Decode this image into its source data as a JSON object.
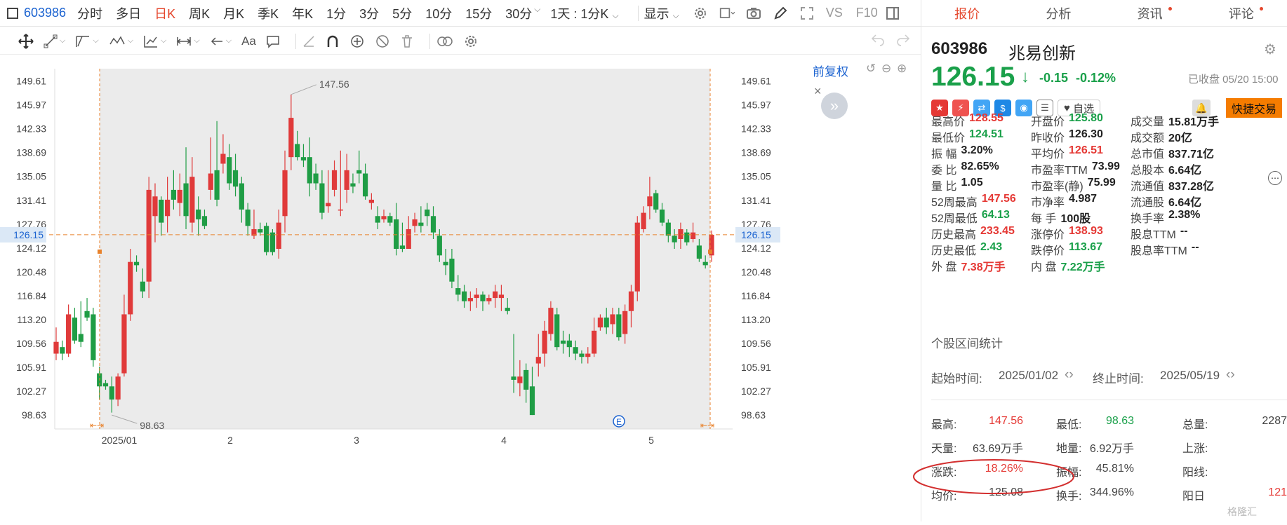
{
  "topbar": {
    "code": "603986",
    "periods": [
      "分时",
      "多日",
      "日K",
      "周K",
      "月K",
      "季K",
      "年K",
      "1分",
      "3分",
      "5分",
      "10分",
      "15分",
      "30分"
    ],
    "active": "日K",
    "range": "1天 : 1分K",
    "display": "显示",
    "vs": "VS",
    "f10": "F10"
  },
  "chart": {
    "restore": "前复权",
    "price_ticks": [
      "149.61",
      "145.97",
      "142.33",
      "138.69",
      "135.05",
      "131.41",
      "127.76",
      "124.12",
      "120.48",
      "116.84",
      "113.20",
      "109.56",
      "105.91",
      "102.27",
      "98.63"
    ],
    "current_price": "126.15",
    "high_label": "147.56",
    "low_label": "98.63",
    "x_labels": [
      "2025/01",
      "2",
      "3",
      "4",
      "5"
    ],
    "marker": "E"
  },
  "candles": [
    [
      108,
      109.8,
      107,
      112
    ],
    [
      109,
      108,
      107,
      110
    ],
    [
      108,
      114,
      107.5,
      115.5
    ],
    [
      113.5,
      110,
      109.5,
      115
    ],
    [
      111,
      109.8,
      109,
      116
    ],
    [
      114.5,
      113.5,
      113,
      116.5
    ],
    [
      114,
      107,
      106,
      115
    ],
    [
      105,
      103,
      101,
      106
    ],
    [
      103.5,
      103,
      102.5,
      104
    ],
    [
      103,
      101,
      99,
      104.5
    ],
    [
      101,
      104.5,
      100,
      105
    ],
    [
      105,
      114,
      104.5,
      117
    ],
    [
      114,
      122,
      113,
      124
    ],
    [
      122,
      121.5,
      120.5,
      123
    ],
    [
      119,
      117.5,
      116.5,
      121
    ],
    [
      119,
      133,
      116.5,
      135
    ],
    [
      129,
      132,
      125,
      134
    ],
    [
      131.5,
      128,
      126,
      132
    ],
    [
      129,
      131.5,
      126.5,
      135
    ],
    [
      133,
      131.5,
      130,
      136
    ],
    [
      131,
      133,
      129,
      135.5
    ],
    [
      134,
      129,
      127,
      139.5
    ],
    [
      128,
      135,
      126.5,
      138
    ],
    [
      130,
      128.5,
      126,
      132
    ],
    [
      129,
      127.5,
      127,
      130
    ],
    [
      133,
      135.5,
      131.5,
      141
    ],
    [
      136,
      131.5,
      130.5,
      143.5
    ],
    [
      137,
      138.5,
      135.5,
      141.5
    ],
    [
      138,
      134,
      133,
      140
    ],
    [
      136,
      133.5,
      132,
      138.5
    ],
    [
      134,
      130,
      128,
      135
    ],
    [
      130,
      127.5,
      126,
      131
    ],
    [
      126,
      127,
      125.5,
      130
    ],
    [
      127,
      126.5,
      126,
      128
    ],
    [
      127.5,
      123.5,
      123,
      128
    ],
    [
      126.5,
      123.5,
      123,
      127
    ],
    [
      124,
      128,
      122.5,
      130
    ],
    [
      129,
      136,
      126.5,
      139
    ],
    [
      138,
      144,
      136,
      147.56
    ],
    [
      140,
      138,
      137.5,
      142
    ],
    [
      138,
      137.5,
      136.5,
      140
    ],
    [
      138,
      134,
      132,
      141
    ],
    [
      135.5,
      134,
      133,
      137
    ],
    [
      134,
      129.5,
      128.5,
      136
    ],
    [
      130.5,
      131,
      129.5,
      136
    ],
    [
      133,
      136,
      132,
      137.5
    ],
    [
      130,
      130,
      129,
      139
    ],
    [
      133,
      136,
      131,
      138.5
    ],
    [
      134,
      133.5,
      132.5,
      135.5
    ],
    [
      136,
      135.5,
      134,
      139
    ],
    [
      135.5,
      132,
      131.5,
      137
    ],
    [
      131,
      131.5,
      130,
      132.5
    ],
    [
      129,
      128,
      127,
      130.5
    ],
    [
      128.5,
      129,
      128,
      130
    ],
    [
      129,
      128,
      127.5,
      129.5
    ],
    [
      128.5,
      124,
      123,
      131
    ],
    [
      124.5,
      124,
      123.5,
      128
    ],
    [
      124,
      127,
      124,
      129
    ],
    [
      127.5,
      128.5,
      126.5,
      129.5
    ],
    [
      128,
      127.5,
      126.5,
      130.5
    ],
    [
      130,
      129,
      127.5,
      131
    ],
    [
      129,
      126.5,
      125.5,
      130.5
    ],
    [
      126,
      123,
      122,
      127
    ],
    [
      122,
      121.5,
      120,
      124
    ],
    [
      122.5,
      119,
      118,
      124
    ],
    [
      118,
      117,
      116,
      120
    ],
    [
      117.5,
      116,
      115,
      118.5
    ],
    [
      116,
      116.5,
      114.5,
      117.5
    ],
    [
      116.5,
      117,
      115,
      118
    ],
    [
      117,
      116,
      114.5,
      117.5
    ],
    [
      116,
      116.5,
      115.5,
      117
    ],
    [
      116.5,
      117.5,
      115,
      118.5
    ],
    [
      116.5,
      117,
      114.5,
      118.5
    ],
    [
      115,
      114.5,
      114,
      116.5
    ],
    [
      104.5,
      104,
      102,
      111
    ],
    [
      103.5,
      104.5,
      101.5,
      107
    ],
    [
      105.5,
      102.5,
      100.5,
      106.5
    ],
    [
      103,
      98.63,
      98.63,
      106
    ],
    [
      106.5,
      107.5,
      104.5,
      111
    ],
    [
      108,
      111.5,
      106,
      113
    ],
    [
      111,
      115,
      110,
      116
    ],
    [
      114,
      109,
      108.5,
      115
    ],
    [
      110,
      109.5,
      108,
      111.5
    ],
    [
      110,
      109,
      107.5,
      111
    ],
    [
      109,
      108,
      107,
      110
    ],
    [
      108,
      107.5,
      106.5,
      108.5
    ],
    [
      107.5,
      108,
      106.5,
      109
    ],
    [
      108,
      111.5,
      107.5,
      113.5
    ],
    [
      112,
      113.5,
      111.5,
      114
    ],
    [
      113.5,
      112,
      111,
      115
    ],
    [
      112.5,
      114,
      111,
      115
    ],
    [
      114,
      110.5,
      110,
      115
    ],
    [
      111,
      114.5,
      109.5,
      115.5
    ],
    [
      114.5,
      117.5,
      112,
      118.5
    ],
    [
      117.5,
      128,
      116,
      129
    ],
    [
      127,
      129.5,
      126.5,
      130.5
    ],
    [
      130.5,
      132,
      128.5,
      135
    ],
    [
      132.5,
      130,
      129.5,
      133
    ],
    [
      130,
      128,
      127.5,
      131
    ],
    [
      128,
      126,
      125,
      128.5
    ],
    [
      126,
      125,
      124,
      127
    ],
    [
      125.5,
      127,
      124,
      128
    ],
    [
      126.5,
      125,
      124.5,
      127
    ],
    [
      125.5,
      126.5,
      125,
      128
    ],
    [
      124.5,
      122.5,
      122,
      125.5
    ],
    [
      122,
      121.5,
      121,
      123
    ],
    [
      123,
      126.15,
      122,
      126.8
    ]
  ],
  "right_panel": {
    "tabs": [
      "报价",
      "分析",
      "资讯",
      "评论"
    ],
    "active": "报价",
    "code": "603986",
    "name": "兆易创新",
    "price": "126.15",
    "change": "-0.15",
    "pct": "-0.12%",
    "closed": "已收盘 05/20 15:00",
    "watch": "自选",
    "quick_trade": "快捷交易",
    "stats": [
      [
        [
          "最高价",
          "128.55",
          "red"
        ],
        [
          "开盘价",
          "125.80",
          "green"
        ],
        [
          "成交量",
          "15.81万手",
          "dark"
        ]
      ],
      [
        [
          "最低价",
          "124.51",
          "green"
        ],
        [
          "昨收价",
          "126.30",
          "dark"
        ],
        [
          "成交额",
          "20亿",
          "dark"
        ]
      ],
      [
        [
          "振  幅",
          "3.20%",
          "dark"
        ],
        [
          "平均价",
          "126.51",
          "red"
        ],
        [
          "总市值",
          "837.71亿",
          "dark"
        ]
      ],
      [
        [
          "委  比",
          "82.65%",
          "dark"
        ],
        [
          "市盈率TTM",
          "73.99",
          "dark"
        ],
        [
          "总股本",
          "6.64亿",
          "dark"
        ]
      ],
      [
        [
          "量  比",
          "1.05",
          "dark"
        ],
        [
          "市盈率(静)",
          "75.99",
          "dark"
        ],
        [
          "流通值",
          "837.28亿",
          "dark"
        ]
      ],
      [
        [
          "52周最高",
          "147.56",
          "red"
        ],
        [
          "市净率",
          "4.987",
          "dark"
        ],
        [
          "流通股",
          "6.64亿",
          "dark"
        ]
      ],
      [
        [
          "52周最低",
          "64.13",
          "green"
        ],
        [
          "每  手",
          "100股",
          "dark"
        ],
        [
          "换手率",
          "2.38%",
          "dark"
        ]
      ],
      [
        [
          "历史最高",
          "233.45",
          "red"
        ],
        [
          "涨停价",
          "138.93",
          "red"
        ],
        [
          "股息TTM",
          "--",
          "dark"
        ]
      ],
      [
        [
          "历史最低",
          "2.43",
          "green"
        ],
        [
          "跌停价",
          "113.67",
          "green"
        ],
        [
          "股息率TTM",
          "--",
          "dark"
        ]
      ],
      [
        [
          "外  盘",
          "7.38万手",
          "red"
        ],
        [
          "内  盘",
          "7.22万手",
          "green"
        ]
      ]
    ],
    "interval_title": "个股区间统计",
    "start_label": "起始时间:",
    "start": "2025/01/02",
    "end_label": "终止时间:",
    "end": "2025/05/19",
    "interval": [
      [
        [
          "最高:",
          "147.56",
          "red"
        ],
        [
          "最低:",
          "98.63",
          "green"
        ],
        [
          "总量:",
          "2287",
          ""
        ]
      ],
      [
        [
          "天量:",
          "63.69万手",
          ""
        ],
        [
          "地量:",
          "6.92万手",
          ""
        ],
        [
          "上涨:",
          "",
          ""
        ]
      ],
      [
        [
          "涨跌:",
          "18.26%",
          "red"
        ],
        [
          "振幅:",
          "45.81%",
          ""
        ],
        [
          "阳线:",
          "",
          ""
        ]
      ],
      [
        [
          "均价:",
          "125.08",
          ""
        ],
        [
          "换手:",
          "344.96%",
          ""
        ],
        [
          "阳日",
          "121",
          "red"
        ]
      ]
    ],
    "watermark": "格隆汇"
  }
}
